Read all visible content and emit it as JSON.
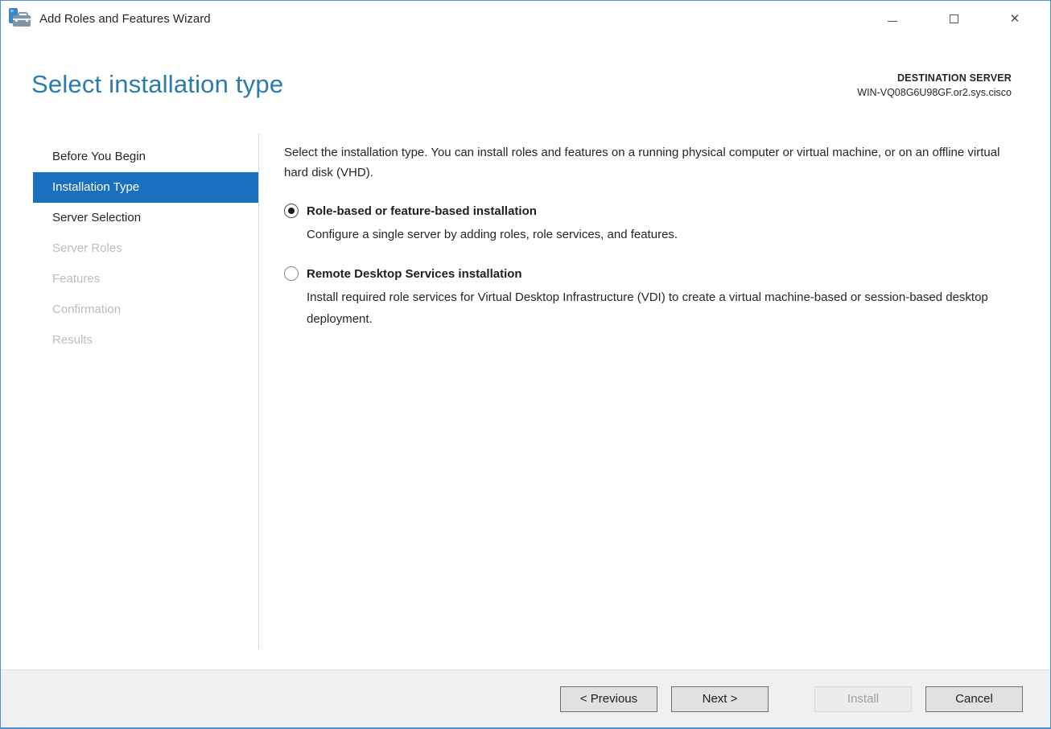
{
  "window": {
    "title": "Add Roles and Features Wizard",
    "icons": {
      "app": "toolbox-icon",
      "minimize": "minimize-icon",
      "maximize": "maximize-icon",
      "close": "✕"
    }
  },
  "header": {
    "title": "Select installation type",
    "destination_label": "DESTINATION SERVER",
    "destination_server": "WIN-VQ08G6U98GF.or2.sys.cisco"
  },
  "sidebar": {
    "items": [
      {
        "label": "Before You Begin",
        "state": "enabled"
      },
      {
        "label": "Installation Type",
        "state": "selected"
      },
      {
        "label": "Server Selection",
        "state": "enabled"
      },
      {
        "label": "Server Roles",
        "state": "disabled"
      },
      {
        "label": "Features",
        "state": "disabled"
      },
      {
        "label": "Confirmation",
        "state": "disabled"
      },
      {
        "label": "Results",
        "state": "disabled"
      }
    ]
  },
  "main": {
    "intro": "Select the installation type. You can install roles and features on a running physical computer or virtual machine, or on an offline virtual hard disk (VHD).",
    "options": [
      {
        "label": "Role-based or feature-based installation",
        "description": "Configure a single server by adding roles, role services, and features.",
        "state": "selected"
      },
      {
        "label": "Remote Desktop Services installation",
        "description": "Install required role services for Virtual Desktop Infrastructure (VDI) to create a virtual machine-based or session-based desktop deployment.",
        "state": "unselected"
      }
    ]
  },
  "footer": {
    "buttons": [
      {
        "label": "< Previous",
        "state": "enabled"
      },
      {
        "label": "Next >",
        "state": "enabled"
      },
      {
        "label": "Install",
        "state": "disabled"
      },
      {
        "label": "Cancel",
        "state": "enabled"
      }
    ]
  },
  "colors": {
    "accent_blue": "#1a70bf",
    "heading_blue": "#2b7cab",
    "window_border": "#4a90d2",
    "footer_bg": "#f0f0f0"
  }
}
